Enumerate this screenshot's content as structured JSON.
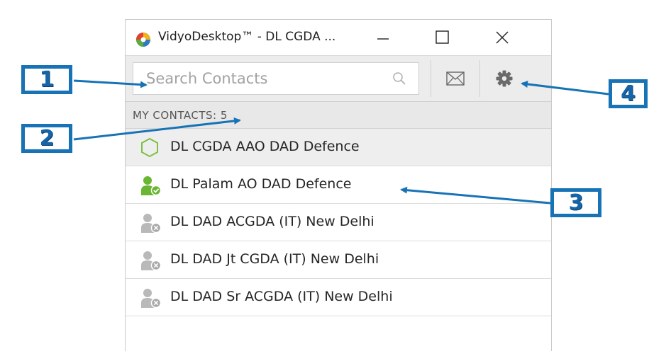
{
  "window": {
    "title": "VidyoDesktop™ - DL CGDA ..."
  },
  "search": {
    "placeholder": "Search Contacts"
  },
  "contacts_header": "MY CONTACTS: 5",
  "contacts": [
    {
      "name": "DL CGDA AAO DAD Defence",
      "status": "self",
      "icon": "hexagon-outline-icon"
    },
    {
      "name": "DL Palam AO DAD Defence",
      "status": "online",
      "icon": "user-online-icon"
    },
    {
      "name": "DL DAD ACGDA (IT) New Delhi",
      "status": "offline",
      "icon": "user-offline-icon"
    },
    {
      "name": "DL DAD Jt CGDA (IT) New Delhi",
      "status": "offline",
      "icon": "user-offline-icon"
    },
    {
      "name": "DL DAD Sr ACGDA (IT) New Delhi",
      "status": "offline",
      "icon": "user-offline-icon"
    }
  ],
  "callouts": {
    "one": "1",
    "two": "2",
    "three": "3",
    "four": "4"
  },
  "colors": {
    "callout_blue": "#1773b5",
    "online_green": "#6ab531",
    "offline_gray": "#b9b9b9"
  }
}
